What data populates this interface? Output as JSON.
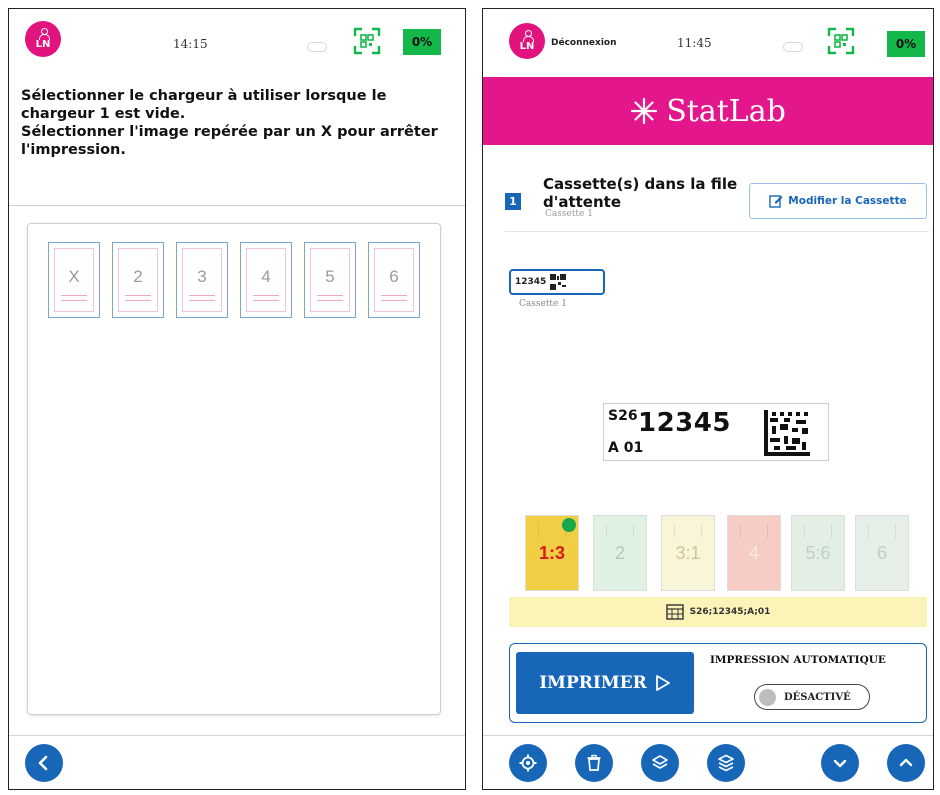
{
  "left_screen": {
    "status": {
      "avatar_initials": "LN",
      "time": "14:15",
      "battery": "0%"
    },
    "instructions": [
      "Sélectionner le chargeur à utiliser lorsque le chargeur 1 est vide.",
      "Sélectionner l'image repérée par un X pour arrêter l'impression."
    ],
    "loaders": [
      "X",
      "2",
      "3",
      "4",
      "5",
      "6"
    ],
    "nav": {
      "back_icon": "chevron-left-icon"
    }
  },
  "right_screen": {
    "status": {
      "avatar_initials": "LN",
      "logout": "Déconnexion",
      "time": "11:45",
      "battery": "0%"
    },
    "brand": "StatLab",
    "queue": {
      "count": "1",
      "title": "Cassette(s) dans la file d'attente",
      "subtitle": "Cassette 1",
      "modify_button": "Modifier la Cassette"
    },
    "mini_cassette": {
      "label": "12345",
      "caption": "Cassette 1"
    },
    "label_preview": {
      "prefix": "S26",
      "number": "12345",
      "sub": "A 01"
    },
    "cassettes": [
      {
        "label": "1:3",
        "color": "#f0cf45",
        "text_color": "#d81b1b",
        "selected": true
      },
      {
        "label": "2",
        "color": "#dff1e2",
        "text_color": "#b6c8bb",
        "selected": false
      },
      {
        "label": "3:1",
        "color": "#f9f5d8",
        "text_color": "#cfc596",
        "selected": false
      },
      {
        "label": "4",
        "color": "#f6ccc4",
        "text_color": "#f1ebe9",
        "selected": false
      },
      {
        "label": "5:6",
        "color": "#e3efe5",
        "text_color": "#bfd0c4",
        "selected": false
      },
      {
        "label": "6",
        "color": "#e6eee8",
        "text_color": "#c3cdc6",
        "selected": false
      }
    ],
    "code_strip": "S26;12345;A;01",
    "print": {
      "button": "IMPRIMER",
      "auto_label": "IMPRESSION AUTOMATIQUE",
      "toggle": "DÉSACTIVÉ"
    },
    "nav_icons": [
      "settings-icon",
      "trash-icon",
      "layers-icon",
      "stack-icon",
      "chevron-down-icon",
      "chevron-up-icon"
    ]
  },
  "colors": {
    "brand_pink": "#e3168c",
    "primary_blue": "#1766b8",
    "battery_green": "#14b84a"
  }
}
